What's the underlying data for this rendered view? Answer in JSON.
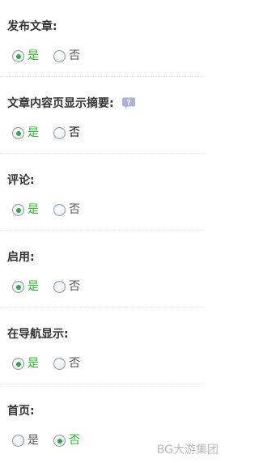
{
  "colors": {
    "selected_label": "#27b427",
    "radio_dot": "#34a449",
    "title_text": "#333333"
  },
  "sections": [
    {
      "title": "发布文章:",
      "yes": "是",
      "no": "否",
      "selected": "yes"
    },
    {
      "title": "文章内容页显示摘要:",
      "help_icon": "help-bubble-icon",
      "yes": "是",
      "no": "否",
      "selected": "yes"
    },
    {
      "title": "评论:",
      "yes": "是",
      "no": "否",
      "selected": "yes"
    },
    {
      "title": "启用:",
      "yes": "是",
      "no": "否",
      "selected": "yes"
    },
    {
      "title": "在导航显示:",
      "yes": "是",
      "no": "否",
      "selected": "yes"
    },
    {
      "title": "首页:",
      "yes": "是",
      "no": "否",
      "selected": "no"
    }
  ],
  "watermark": "BG大游集团"
}
